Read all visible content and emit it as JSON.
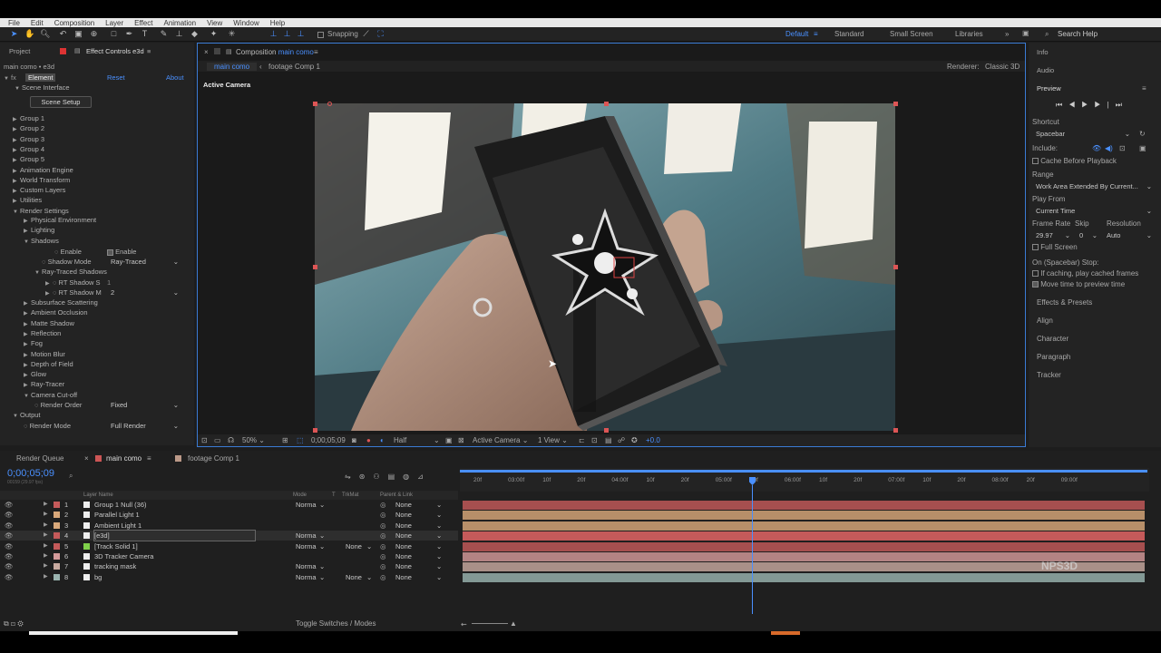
{
  "menu": [
    "File",
    "Edit",
    "Composition",
    "Layer",
    "Effect",
    "Animation",
    "View",
    "Window",
    "Help"
  ],
  "toolbar": {
    "snapping": "Snapping",
    "workspaces": [
      "Default",
      "Standard",
      "Small Screen",
      "Libraries"
    ],
    "search_help": "Search Help"
  },
  "left_panel": {
    "tabs": [
      "Project",
      "Effect Controls e3d"
    ],
    "breadcrumb": "main como • e3d",
    "effect_name": "Element",
    "reset": "Reset",
    "about": "About",
    "scene_interface": "Scene Interface",
    "scene_setup": "Scene Setup",
    "groups": [
      "Group 1",
      "Group 2",
      "Group 3",
      "Group 4",
      "Group 5",
      "Animation Engine",
      "World Transform",
      "Custom Layers",
      "Utilities",
      "Render Settings"
    ],
    "render_items": [
      "Physical Environment",
      "Lighting",
      "Shadows"
    ],
    "enable_label": "Enable",
    "enable_value": "Enable",
    "shadow_mode_label": "Shadow Mode",
    "shadow_mode_value": "Ray-Traced",
    "rt_shadows": "Ray-Traced Shadows",
    "rt_s_label": "RT Shadow S",
    "rt_s_value": "1",
    "rt_m_label": "RT Shadow M",
    "rt_m_value": "2",
    "more_items": [
      "Subsurface Scattering",
      "Ambient Occlusion",
      "Matte Shadow",
      "Reflection",
      "Fog",
      "Motion Blur",
      "Depth of Field",
      "Glow",
      "Ray-Tracer",
      "Camera Cut-off"
    ],
    "render_order_label": "Render Order",
    "render_order_value": "Fixed",
    "output": "Output",
    "render_mode_label": "Render Mode",
    "render_mode_value": "Full Render"
  },
  "comp": {
    "tab_prefix": "Composition",
    "tab_name": "main como",
    "subtabs": [
      "main como",
      "footage Comp 1"
    ],
    "renderer_label": "Renderer:",
    "renderer_value": "Classic 3D",
    "view_label": "Active Camera",
    "zoom": "50%",
    "time": "0;00;05;09",
    "quality": "Half",
    "camera": "Active Camera",
    "views": "1 View",
    "exposure": "+0.0"
  },
  "right_panel": {
    "sections_top": [
      "Info",
      "Audio",
      "Preview"
    ],
    "shortcut_label": "Shortcut",
    "shortcut_value": "Spacebar",
    "include_label": "Include:",
    "cache_label": "Cache Before Playback",
    "range_label": "Range",
    "range_value": "Work Area Extended By Current...",
    "play_from_label": "Play From",
    "play_from_value": "Current Time",
    "frame_rate_label": "Frame Rate",
    "skip_label": "Skip",
    "resolution_label": "Resolution",
    "frame_rate_value": "29.97",
    "skip_value": "0",
    "resolution_value": "Auto",
    "full_screen": "Full Screen",
    "on_stop": "On (Spacebar) Stop:",
    "if_caching": "If caching, play cached frames",
    "move_time": "Move time to preview time",
    "sections_bottom": [
      "Effects & Presets",
      "Align",
      "Character",
      "Paragraph",
      "Tracker"
    ]
  },
  "timeline": {
    "tabs": [
      "Render Queue",
      "main como",
      "footage Comp 1"
    ],
    "timecode": "0;00;05;09",
    "timecode_sub": "00159 (29.97 fps)",
    "columns": [
      "Layer Name",
      "Mode",
      "T",
      "TrkMat",
      "Parent & Link"
    ],
    "layers": [
      {
        "num": "1",
        "name": "Group 1 Null (36)",
        "mode": "Norma",
        "trk": "",
        "parent": "None",
        "color": "#c55a5a"
      },
      {
        "num": "2",
        "name": "Parallel Light 1",
        "mode": "",
        "trk": "",
        "parent": "None",
        "color": "#d9a87a"
      },
      {
        "num": "3",
        "name": "Ambient Light 1",
        "mode": "",
        "trk": "",
        "parent": "None",
        "color": "#d9a87a"
      },
      {
        "num": "4",
        "name": "[e3d]",
        "mode": "Norma",
        "trk": "",
        "parent": "None",
        "color": "#c55a5a"
      },
      {
        "num": "5",
        "name": "[Track Solid 1]",
        "mode": "Norma",
        "trk": "None",
        "parent": "None",
        "color": "#c55a5a"
      },
      {
        "num": "6",
        "name": "3D Tracker Camera",
        "mode": "",
        "trk": "",
        "parent": "None",
        "color": "#d49a9a"
      },
      {
        "num": "7",
        "name": "tracking mask",
        "mode": "Norma",
        "trk": "",
        "parent": "None",
        "color": "#c8aaa0"
      },
      {
        "num": "8",
        "name": "bg",
        "mode": "Norma",
        "trk": "None",
        "parent": "None",
        "color": "#9ab4b0"
      }
    ],
    "ruler": [
      "20f",
      "03:00f",
      "10f",
      "20f",
      "04:00f",
      "10f",
      "20f",
      "05:00f",
      "20f",
      "06:00f",
      "10f",
      "20f",
      "07:00f",
      "10f",
      "20f",
      "08:00f",
      "20f",
      "09:00f"
    ],
    "toggle": "Toggle Switches / Modes",
    "watermark": "NPS3D"
  }
}
